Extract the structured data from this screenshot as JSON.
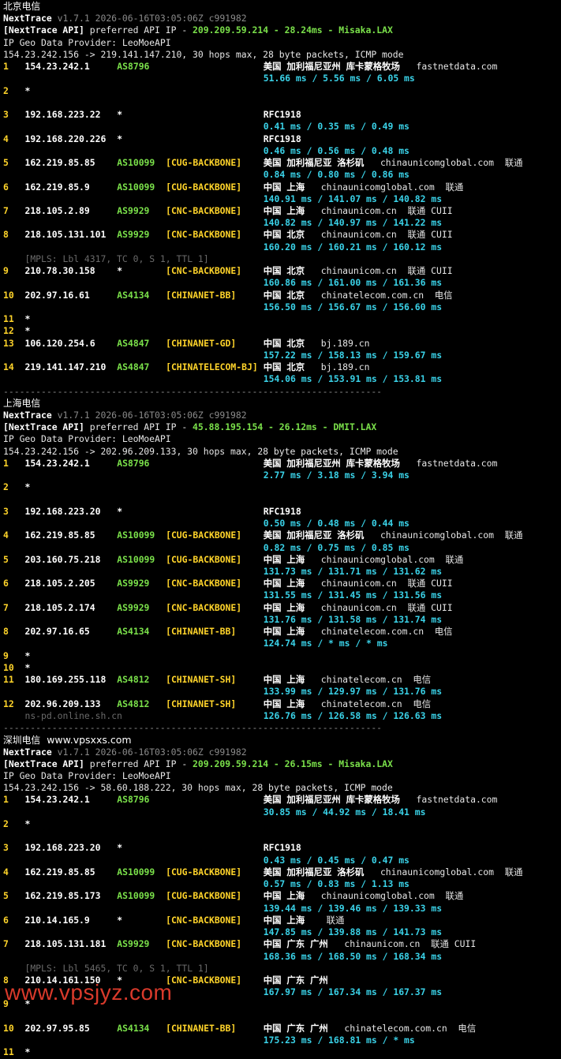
{
  "watermark": "www.vpsjyz.com",
  "sections": [
    {
      "title": "北京电信",
      "site": "",
      "nt_name": "NextTrace",
      "nt_version": "v1.7.1 2026-06-16T03:05:06Z c991982",
      "api_prefix": "[NextTrace API]",
      "api_mid": "preferred API IP - ",
      "api_ip": "209.209.59.214",
      "api_sep": " - ",
      "api_ms": "28.24ms",
      "api_sep2": " - ",
      "api_node": "Misaka.LAX",
      "geo": "IP Geo Data Provider: LeoMoeAPI",
      "route": "154.23.242.156 -> 219.141.147.210, 30 hops max, 28 byte packets, ICMP mode",
      "hops": [
        {
          "n": "1",
          "ip": "154.23.242.1",
          "as": "AS8796",
          "tag": "",
          "geo": "美国 加利福尼亚州 库卡蒙格牧场",
          "host": "fastnetdata.com",
          "isp": "",
          "rtt": "51.66 ms / 5.56 ms / 6.05 ms"
        },
        {
          "n": "2",
          "ip": "*"
        },
        {
          "n": "3",
          "ip": "192.168.223.22",
          "as": "*",
          "tag": "",
          "geo": "RFC1918",
          "host": "",
          "isp": "",
          "rtt": "0.41 ms / 0.35 ms / 0.49 ms"
        },
        {
          "n": "4",
          "ip": "192.168.220.226",
          "as": "*",
          "tag": "",
          "geo": "RFC1918",
          "host": "",
          "isp": "",
          "rtt": "0.46 ms / 0.56 ms / 0.48 ms"
        },
        {
          "n": "5",
          "ip": "162.219.85.85",
          "as": "AS10099",
          "tag": "[CUG-BACKBONE]",
          "geo": "美国 加利福尼亚 洛杉矶",
          "host": "chinaunicomglobal.com",
          "isp": "联通",
          "rtt": "0.84 ms / 0.80 ms / 0.86 ms"
        },
        {
          "n": "6",
          "ip": "162.219.85.9",
          "as": "AS10099",
          "tag": "[CUG-BACKBONE]",
          "geo": "中国 上海",
          "host": "chinaunicomglobal.com",
          "isp": "联通",
          "rtt": "140.91 ms / 141.07 ms / 140.82 ms"
        },
        {
          "n": "7",
          "ip": "218.105.2.89",
          "as": "AS9929",
          "tag": "[CNC-BACKBONE]",
          "geo": "中国 上海",
          "host": "chinaunicom.cn",
          "isp": "联通 CUII",
          "rtt": "140.82 ms / 140.97 ms / 141.22 ms"
        },
        {
          "n": "8",
          "ip": "218.105.131.101",
          "as": "AS9929",
          "tag": "[CNC-BACKBONE]",
          "geo": "中国 北京",
          "host": "chinaunicom.cn",
          "isp": "联通 CUII",
          "rtt": "160.20 ms / 160.21 ms / 160.12 ms",
          "mpls": "[MPLS: Lbl 4317, TC 0, S 1, TTL 1]"
        },
        {
          "n": "9",
          "ip": "210.78.30.158",
          "as": "*",
          "tag": "[CNC-BACKBONE]",
          "geo": "中国 北京",
          "host": "chinaunicom.cn",
          "isp": "联通 CUII",
          "rtt": "160.86 ms / 161.00 ms / 161.36 ms"
        },
        {
          "n": "10",
          "ip": "202.97.16.61",
          "as": "AS4134",
          "tag": "[CHINANET-BB]",
          "geo": "中国 北京",
          "host": "chinatelecom.com.cn",
          "isp": "电信",
          "rtt": "156.50 ms / 156.67 ms / 156.60 ms"
        },
        {
          "n": "11",
          "ip": "*",
          "compact": true
        },
        {
          "n": "12",
          "ip": "*",
          "compact": true
        },
        {
          "n": "13",
          "ip": "106.120.254.6",
          "as": "AS4847",
          "tag": "[CHINANET-GD]",
          "geo": "中国 北京",
          "host": "bj.189.cn",
          "isp": "",
          "rtt": "157.22 ms / 158.13 ms / 159.67 ms"
        },
        {
          "n": "14",
          "ip": "219.141.147.210",
          "as": "AS4847",
          "tag": "[CHINATELECOM-BJ]",
          "geo": "中国 北京",
          "host": "bj.189.cn",
          "isp": "",
          "rtt": "154.06 ms / 153.91 ms / 153.81 ms"
        }
      ]
    },
    {
      "title": "上海电信",
      "site": "",
      "nt_name": "NextTrace",
      "nt_version": "v1.7.1 2026-06-16T03:05:06Z c991982",
      "api_prefix": "[NextTrace API]",
      "api_mid": "preferred API IP - ",
      "api_ip": "45.88.195.154",
      "api_sep": " - ",
      "api_ms": "26.12ms",
      "api_sep2": " - ",
      "api_node": "DMIT.LAX",
      "geo": "IP Geo Data Provider: LeoMoeAPI",
      "route": "154.23.242.156 -> 202.96.209.133, 30 hops max, 28 byte packets, ICMP mode",
      "hops": [
        {
          "n": "1",
          "ip": "154.23.242.1",
          "as": "AS8796",
          "tag": "",
          "geo": "美国 加利福尼亚州 库卡蒙格牧场",
          "host": "fastnetdata.com",
          "isp": "",
          "rtt": "2.77 ms / 3.18 ms / 3.94 ms"
        },
        {
          "n": "2",
          "ip": "*"
        },
        {
          "n": "3",
          "ip": "192.168.223.20",
          "as": "*",
          "tag": "",
          "geo": "RFC1918",
          "host": "",
          "isp": "",
          "rtt": "0.50 ms / 0.48 ms / 0.44 ms"
        },
        {
          "n": "4",
          "ip": "162.219.85.85",
          "as": "AS10099",
          "tag": "[CUG-BACKBONE]",
          "geo": "美国 加利福尼亚 洛杉矶",
          "host": "chinaunicomglobal.com",
          "isp": "联通",
          "rtt": "0.82 ms / 0.75 ms / 0.85 ms"
        },
        {
          "n": "5",
          "ip": "203.160.75.218",
          "as": "AS10099",
          "tag": "[CUG-BACKBONE]",
          "geo": "中国 上海",
          "host": "chinaunicomglobal.com",
          "isp": "联通",
          "rtt": "131.73 ms / 131.71 ms / 131.62 ms"
        },
        {
          "n": "6",
          "ip": "218.105.2.205",
          "as": "AS9929",
          "tag": "[CNC-BACKBONE]",
          "geo": "中国 上海",
          "host": "chinaunicom.cn",
          "isp": "联通 CUII",
          "rtt": "131.55 ms / 131.45 ms / 131.56 ms"
        },
        {
          "n": "7",
          "ip": "218.105.2.174",
          "as": "AS9929",
          "tag": "[CNC-BACKBONE]",
          "geo": "中国 上海",
          "host": "chinaunicom.cn",
          "isp": "联通 CUII",
          "rtt": "131.76 ms / 131.58 ms / 131.74 ms"
        },
        {
          "n": "8",
          "ip": "202.97.16.65",
          "as": "AS4134",
          "tag": "[CHINANET-BB]",
          "geo": "中国 上海",
          "host": "chinatelecom.com.cn",
          "isp": "电信",
          "rtt": "124.74 ms / * ms / * ms"
        },
        {
          "n": "9",
          "ip": "*",
          "compact": true
        },
        {
          "n": "10",
          "ip": "*",
          "compact": true
        },
        {
          "n": "11",
          "ip": "180.169.255.118",
          "as": "AS4812",
          "tag": "[CHINANET-SH]",
          "geo": "中国 上海",
          "host": "chinatelecom.cn",
          "isp": "电信",
          "rtt": "133.99 ms / 129.97 ms / 131.76 ms"
        },
        {
          "n": "12",
          "ip": "202.96.209.133",
          "as": "AS4812",
          "tag": "[CHINANET-SH]",
          "geo": "中国 上海",
          "host": "chinatelecom.cn",
          "isp": "电信",
          "rtt": "126.76 ms / 126.58 ms / 126.63 ms",
          "rdns": "ns-pd.online.sh.cn"
        }
      ]
    },
    {
      "title": "深圳电信",
      "site": "www.vpsxxs.com",
      "nt_name": "NextTrace",
      "nt_version": "v1.7.1 2026-06-16T03:05:06Z c991982",
      "api_prefix": "[NextTrace API]",
      "api_mid": "preferred API IP - ",
      "api_ip": "209.209.59.214",
      "api_sep": " - ",
      "api_ms": "26.15ms",
      "api_sep2": " - ",
      "api_node": "Misaka.LAX",
      "geo": "IP Geo Data Provider: LeoMoeAPI",
      "route": "154.23.242.156 -> 58.60.188.222, 30 hops max, 28 byte packets, ICMP mode",
      "hops": [
        {
          "n": "1",
          "ip": "154.23.242.1",
          "as": "AS8796",
          "tag": "",
          "geo": "美国 加利福尼亚州 库卡蒙格牧场",
          "host": "fastnetdata.com",
          "isp": "",
          "rtt": "30.85 ms / 44.92 ms / 18.41 ms"
        },
        {
          "n": "2",
          "ip": "*"
        },
        {
          "n": "3",
          "ip": "192.168.223.20",
          "as": "*",
          "tag": "",
          "geo": "RFC1918",
          "host": "",
          "isp": "",
          "rtt": "0.43 ms / 0.45 ms / 0.47 ms"
        },
        {
          "n": "4",
          "ip": "162.219.85.85",
          "as": "AS10099",
          "tag": "[CUG-BACKBONE]",
          "geo": "美国 加利福尼亚 洛杉矶",
          "host": "chinaunicomglobal.com",
          "isp": "联通",
          "rtt": "0.57 ms / 0.83 ms / 1.13 ms"
        },
        {
          "n": "5",
          "ip": "162.219.85.173",
          "as": "AS10099",
          "tag": "[CUG-BACKBONE]",
          "geo": "中国 上海",
          "host": "chinaunicomglobal.com",
          "isp": "联通",
          "rtt": "139.44 ms / 139.46 ms / 139.33 ms"
        },
        {
          "n": "6",
          "ip": "210.14.165.9",
          "as": "*",
          "tag": "[CNC-BACKBONE]",
          "geo": "中国 上海",
          "host": "",
          "isp": "联通",
          "rtt": "147.85 ms / 139.88 ms / 141.73 ms"
        },
        {
          "n": "7",
          "ip": "218.105.131.181",
          "as": "AS9929",
          "tag": "[CNC-BACKBONE]",
          "geo": "中国 广东 广州",
          "host": "chinaunicom.cn",
          "isp": "联通 CUII",
          "rtt": "168.36 ms / 168.50 ms / 168.34 ms",
          "mpls": "[MPLS: Lbl 5465, TC 0, S 1, TTL 1]"
        },
        {
          "n": "8",
          "ip": "210.14.161.150",
          "as": "*",
          "tag": "[CNC-BACKBONE]",
          "geo": "中国 广东 广州",
          "host": "",
          "isp": "",
          "rtt": "167.97 ms / 167.34 ms / 167.37 ms"
        },
        {
          "n": "9",
          "ip": "*"
        },
        {
          "n": "10",
          "ip": "202.97.95.85",
          "as": "AS4134",
          "tag": "[CHINANET-BB]",
          "geo": "中国 广东 广州",
          "host": "chinatelecom.com.cn",
          "isp": "电信",
          "rtt": "175.23 ms / 168.81 ms / * ms"
        },
        {
          "n": "11",
          "ip": "*",
          "compact": true
        }
      ]
    }
  ],
  "separator": "----------------------------------------------------------------------"
}
